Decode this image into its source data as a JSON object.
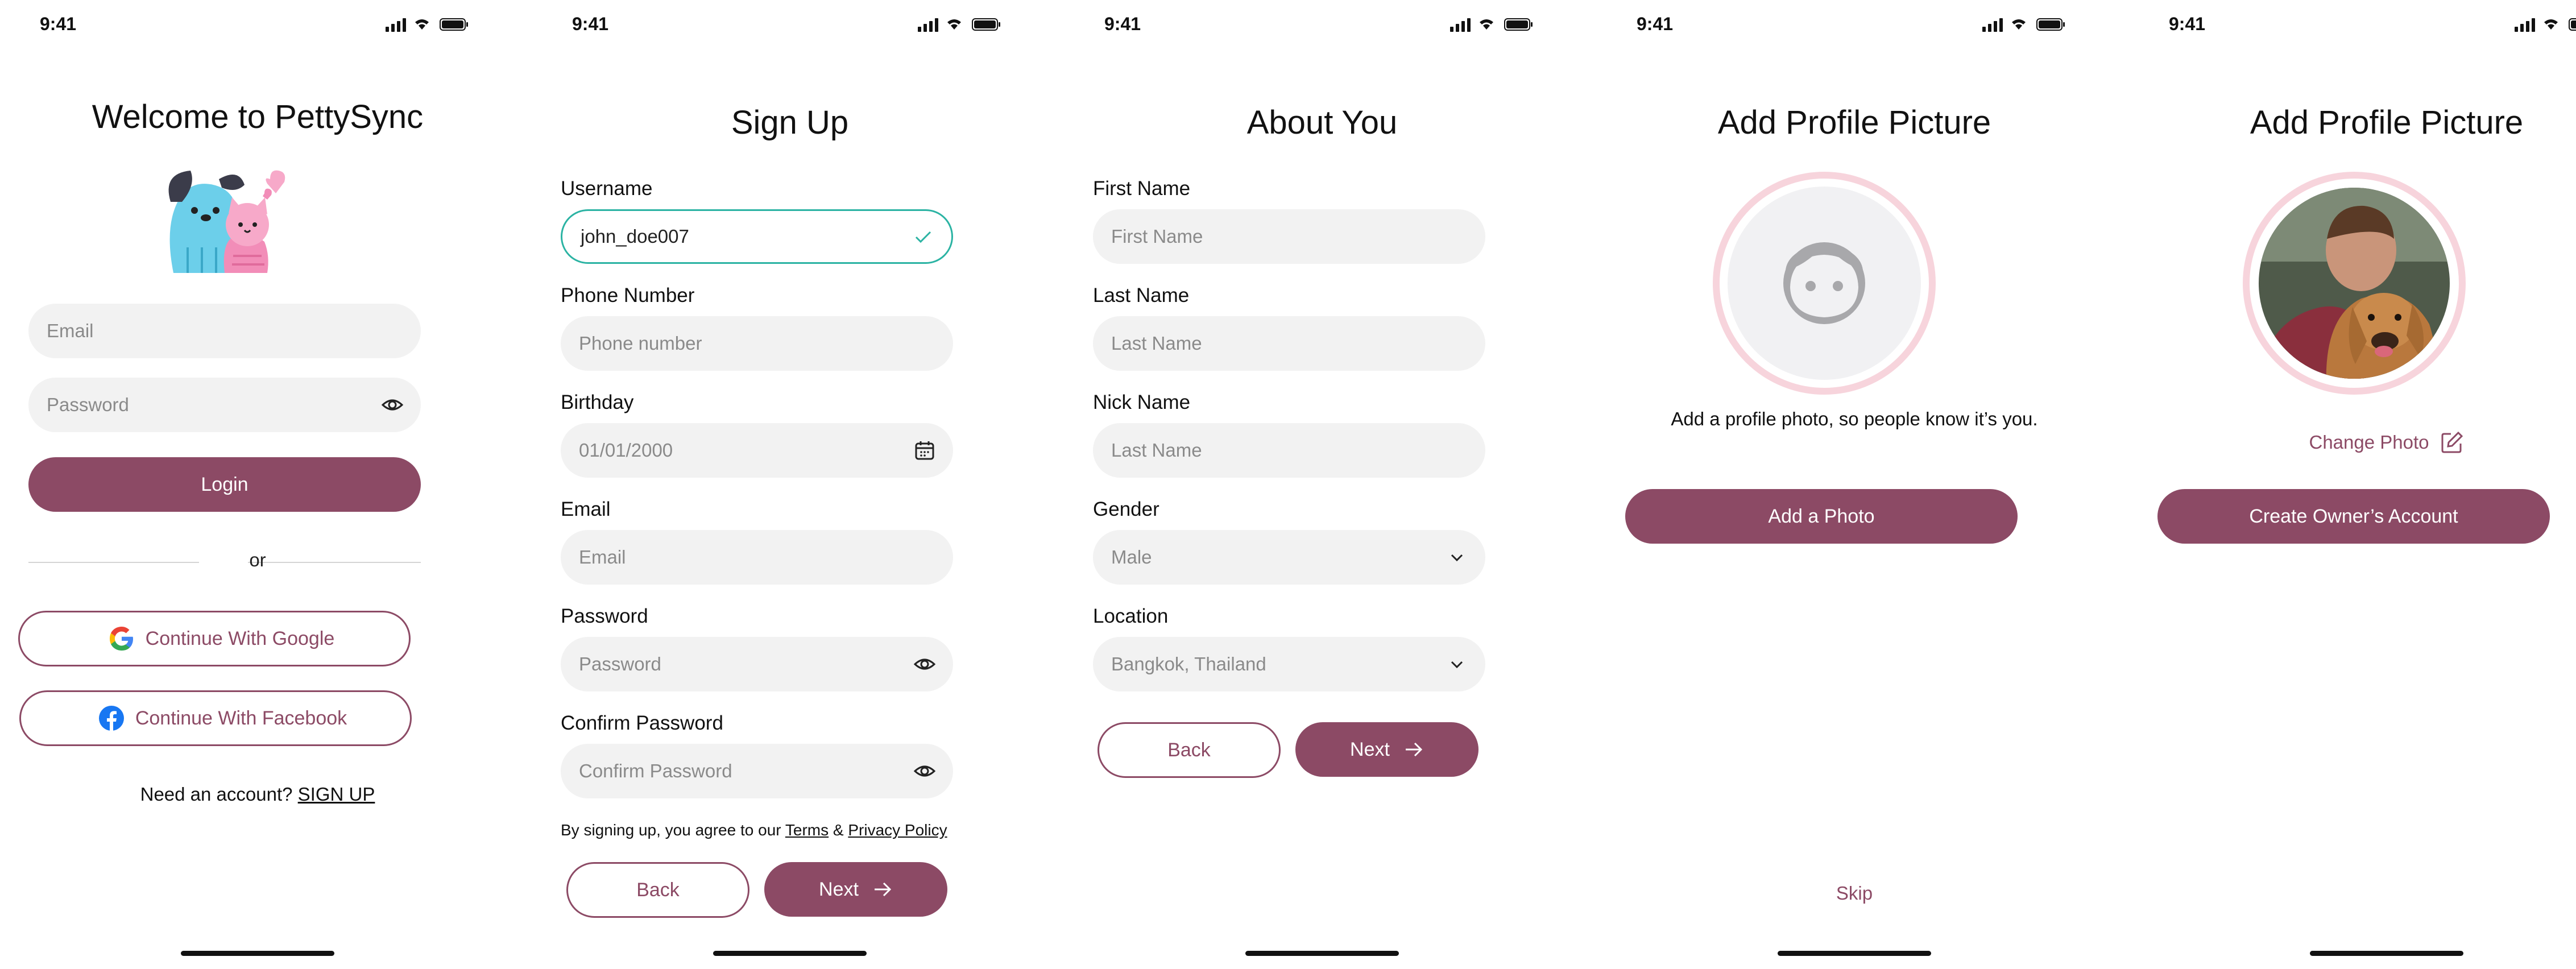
{
  "status_bar": {
    "time": "9:41"
  },
  "colors": {
    "primary": "#8c4a65",
    "focus_border": "#2bb3a3",
    "field_bg": "#f2f2f2",
    "avatar_ring": "#f7d4dc"
  },
  "login": {
    "title": "Welcome to PettySync",
    "email_placeholder": "Email",
    "password_placeholder": "Password",
    "login_button": "Login",
    "divider_text": "or",
    "google_button": "Continue With Google",
    "facebook_button": "Continue With Facebook",
    "signup_prompt": "Need an account?",
    "signup_link": "SIGN UP"
  },
  "signup": {
    "title": "Sign Up",
    "username_label": "Username",
    "username_value": "john_doe007",
    "phone_label": "Phone Number",
    "phone_placeholder": "Phone number",
    "birthday_label": "Birthday",
    "birthday_value": "01/01/2000",
    "email_label": "Email",
    "email_placeholder": "Email",
    "password_label": "Password",
    "password_placeholder": "Password",
    "confirm_label": "Confirm Password",
    "confirm_placeholder": "Confirm Password",
    "terms_prefix": "By signing up, you agree to our",
    "terms_link": "Terms",
    "terms_amp": "&",
    "privacy_link": "Privacy Policy",
    "back_button": "Back",
    "next_button": "Next"
  },
  "about": {
    "title": "About You",
    "first_name_label": "First Name",
    "first_name_placeholder": "First Name",
    "last_name_label": "Last Name",
    "last_name_placeholder": "Last Name",
    "nick_name_label": "Nick Name",
    "nick_name_placeholder": "Last Name",
    "gender_label": "Gender",
    "gender_value": "Male",
    "location_label": "Location",
    "location_value": "Bangkok, Thailand",
    "back_button": "Back",
    "next_button": "Next"
  },
  "add_photo": {
    "title": "Add Profile Picture",
    "description": "Add a profile photo, so people know it’s you.",
    "add_button": "Add a Photo",
    "skip_link": "Skip"
  },
  "change_photo": {
    "title": "Add Profile Picture",
    "change_link": "Change Photo",
    "create_button": "Create Owner’s Account"
  }
}
